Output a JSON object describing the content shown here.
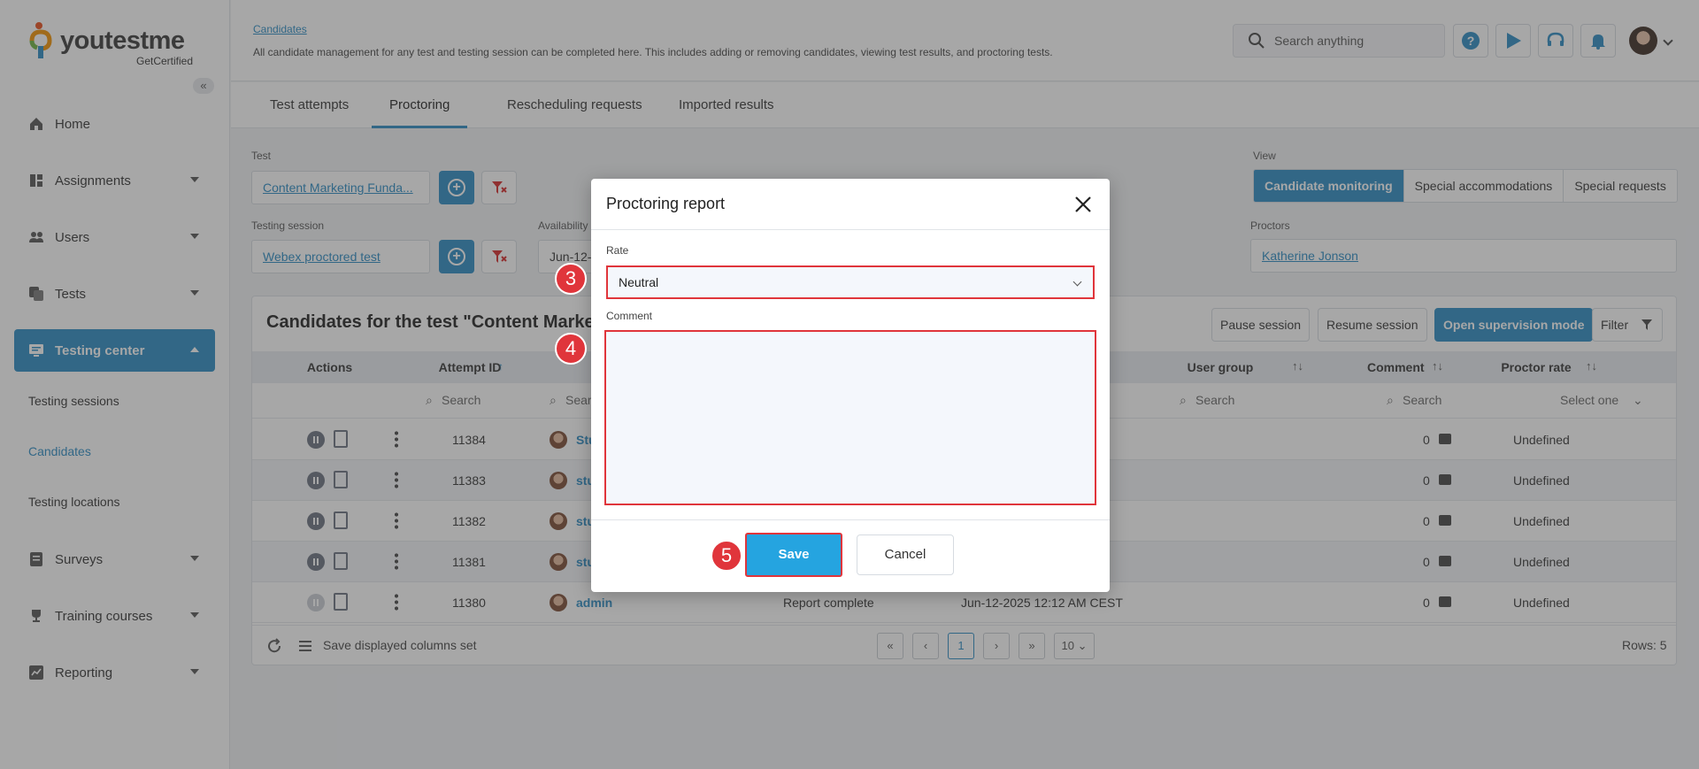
{
  "brand": {
    "name": "youtestme",
    "sub": "GetCertified"
  },
  "sidebar": {
    "collapse_glyph": "«",
    "items": [
      {
        "label": "Home",
        "icon": "home-icon"
      },
      {
        "label": "Assignments",
        "icon": "assignments-icon"
      },
      {
        "label": "Users",
        "icon": "users-icon"
      },
      {
        "label": "Tests",
        "icon": "tests-icon"
      },
      {
        "label": "Testing center",
        "icon": "testing-center-icon"
      },
      {
        "label": "Surveys",
        "icon": "surveys-icon"
      },
      {
        "label": "Training courses",
        "icon": "trophy-icon"
      },
      {
        "label": "Reporting",
        "icon": "reporting-icon"
      }
    ],
    "subitems": [
      "Testing sessions",
      "Candidates",
      "Testing locations"
    ]
  },
  "header": {
    "breadcrumb": "Candidates",
    "description": "All candidate management for any test and testing session can be completed here. This includes adding or removing candidates, viewing test results, and proctoring tests.",
    "search_placeholder": "Search anything"
  },
  "tabs": [
    "Test attempts",
    "Proctoring",
    "Rescheduling requests",
    "Imported results"
  ],
  "filters": {
    "test_label": "Test",
    "test_value": "Content Marketing Funda...",
    "session_label": "Testing session",
    "session_value": "Webex proctored test",
    "availability_label": "Availability",
    "availability_value": "Jun-12-",
    "view_label": "View",
    "view_options": [
      "Candidate monitoring",
      "Special accommodations",
      "Special requests"
    ],
    "proctors_label": "Proctors",
    "proctors_value": "Katherine Jonson"
  },
  "panel": {
    "title": "Candidates for the test \"Content Marketi",
    "buttons": {
      "pause": "Pause session",
      "resume": "Resume session",
      "supervision": "Open supervision mode",
      "filter": "Filter"
    },
    "columns": {
      "actions": "Actions",
      "attempt_id": "Attempt ID",
      "user_group": "User group",
      "comment": "Comment",
      "proctor_rate": "Proctor rate"
    },
    "search_placeholder": "Search",
    "sear_partial": "Sear",
    "select_one": "Select one",
    "rows": [
      {
        "id": "11384",
        "user": "Stu",
        "status": "",
        "date": "",
        "comments": "0",
        "rate": "Undefined"
      },
      {
        "id": "11383",
        "user": "stu",
        "status": "",
        "date": "",
        "comments": "0",
        "rate": "Undefined"
      },
      {
        "id": "11382",
        "user": "stu",
        "status": "",
        "date": "",
        "comments": "0",
        "rate": "Undefined"
      },
      {
        "id": "11381",
        "user": "stu",
        "status": "",
        "date": "",
        "comments": "0",
        "rate": "Undefined"
      },
      {
        "id": "11380",
        "user": "admin",
        "status": "Report complete",
        "date": "Jun-12-2025 12:12 AM CEST",
        "comments": "0",
        "rate": "Undefined"
      }
    ],
    "footer": {
      "save_columns": "Save displayed columns set",
      "page": "1",
      "page_size": "10",
      "rows": "Rows: 5"
    }
  },
  "modal": {
    "title": "Proctoring report",
    "rate_label": "Rate",
    "rate_value": "Neutral",
    "comment_label": "Comment",
    "comment_value": "",
    "save_label": "Save",
    "cancel_label": "Cancel"
  },
  "steps": [
    "3",
    "4",
    "5"
  ],
  "colors": {
    "accent": "#2a8bc4",
    "highlight": "#e0353b",
    "save": "#25a4e0"
  }
}
